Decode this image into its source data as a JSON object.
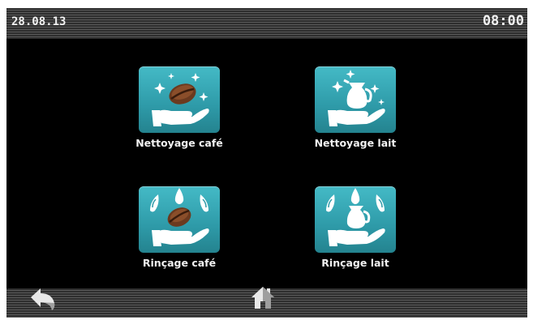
{
  "status_bar": {
    "date": "28.08.13",
    "time": "08:00"
  },
  "tiles": [
    {
      "label": "Nettoyage café",
      "icon": "coffee-bean-cleaning-icon"
    },
    {
      "label": "Nettoyage lait",
      "icon": "milk-jug-cleaning-icon"
    },
    {
      "label": "Rinçage café",
      "icon": "coffee-bean-rinse-icon"
    },
    {
      "label": "Rinçage lait",
      "icon": "milk-jug-rinse-icon"
    }
  ],
  "nav": {
    "back_icon": "back-arrow-icon",
    "home_icon": "home-icon"
  },
  "colors": {
    "tile_teal": "#36a8b4",
    "background": "#000000",
    "text": "#f2f2f2"
  }
}
